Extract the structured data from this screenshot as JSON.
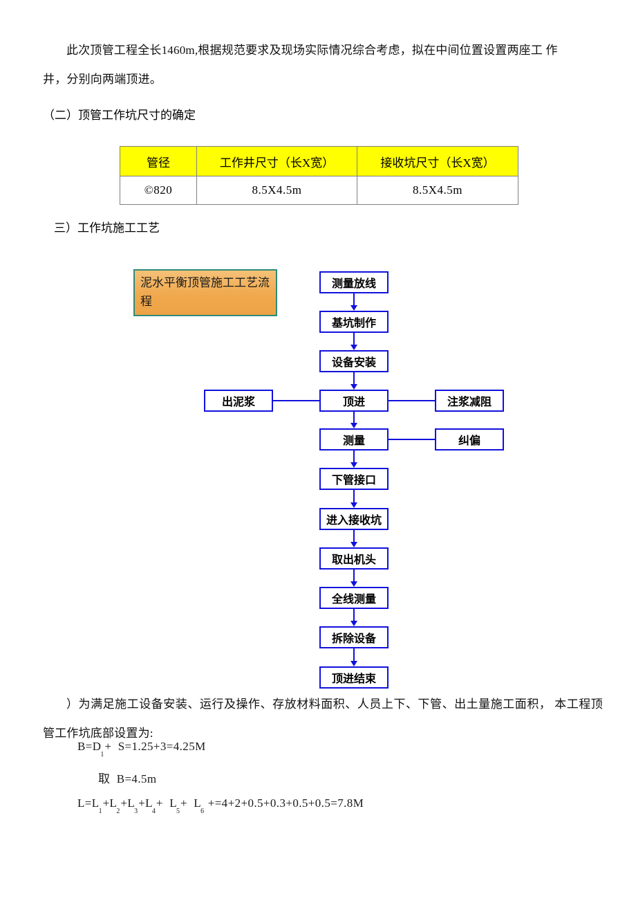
{
  "document": {
    "paragraph_1": {
      "line_1": "此次顶管工程全长1460m,根据规范要求及现场实际情况综合考虑，拟在中间位置设置两座工 作",
      "line_2": "井，分别向两端顶进。"
    },
    "heading_2": "（二）顶管工作坑尺寸的确定",
    "heading_3": "三）工作坑施工工艺",
    "paragraph_2": {
      "line_1": "）为满足施工设备安装、运行及操作、存放材料面积、人员上下、下管、出土量施工面积，",
      "line_2": "本工程顶管工作坑底部设置为:"
    }
  },
  "table": {
    "headers": [
      "管径",
      "工作井尺寸（长X宽）",
      "接收坑尺寸（长X宽）"
    ],
    "rows": [
      [
        "©820",
        "8.5X4.5m",
        "8.5X4.5m"
      ]
    ],
    "header_bg": "#ffff00",
    "border_color": "#808080"
  },
  "flowchart": {
    "title_box": "泥水平衡顶管施工工艺流程",
    "title_box_border": "#2e8b7a",
    "title_box_fill_top": "#f5c178",
    "title_box_fill_bottom": "#eda246",
    "box_border": "#1111dd",
    "main_steps": [
      "测量放线",
      "基坑制作",
      "设备安装",
      "顶进",
      "测量",
      "下管接口",
      "进入接收坑",
      "取出机头",
      "全线测量",
      "拆除设备",
      "顶进结束"
    ],
    "side_left": [
      "出泥浆"
    ],
    "side_right": [
      "注浆减阻",
      "纠偏"
    ]
  },
  "formulas": {
    "line_1_prefix": "B=D",
    "line_1_sub": "1",
    "line_1_suffix": "+  S=1.25+3=4.25M",
    "line_2": "取  B=4.5m",
    "line_3": {
      "parts": [
        {
          "t": "L=L",
          "s": "1"
        },
        {
          "t": "+L",
          "s": "2"
        },
        {
          "t": "+L",
          "s": "3"
        },
        {
          "t": "+L",
          "s": "4"
        },
        {
          "t": "+  L",
          "s": "5"
        },
        {
          "t": "+  L",
          "s": "6"
        },
        {
          "t": " +=4+2+0.5+0.3+0.5+0.5=7.8M",
          "s": ""
        }
      ]
    }
  }
}
